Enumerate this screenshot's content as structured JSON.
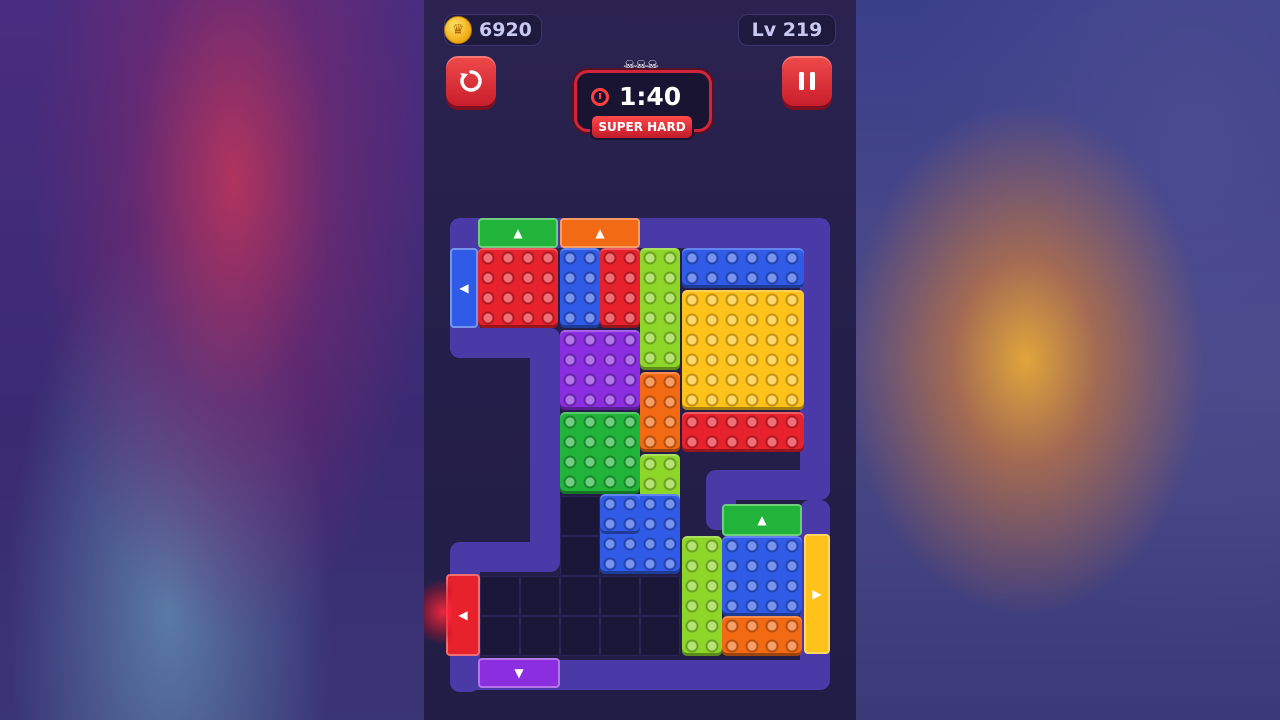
{
  "hud": {
    "coins": "6920",
    "level": "Lv 219",
    "timer": "1:40",
    "difficulty": "SUPER HARD"
  },
  "icons": {
    "coin": "crown-coin-icon",
    "restart": "restart-icon",
    "pause": "pause-icon",
    "timer": "stopwatch-icon",
    "skulls": "skull-icons"
  },
  "colors": {
    "red": "#e8222c",
    "blue": "#2f5be6",
    "green": "#22b43a",
    "lime": "#8ed62a",
    "purple": "#8a2ee0",
    "orange": "#f26a14",
    "yellow": "#ffc21a"
  },
  "board": {
    "blocks": [
      {
        "name": "red-block-2x2",
        "color": "red"
      },
      {
        "name": "blue-block-1x2",
        "color": "blue"
      },
      {
        "name": "red-block-1x2",
        "color": "red"
      },
      {
        "name": "lime-block-1x3",
        "color": "lime"
      },
      {
        "name": "blue-block-3x1",
        "color": "blue"
      },
      {
        "name": "yellow-block-3x3",
        "color": "yellow"
      },
      {
        "name": "purple-block-2x2",
        "color": "purple"
      },
      {
        "name": "orange-block-1x2",
        "color": "orange"
      },
      {
        "name": "red-block-3x1",
        "color": "red"
      },
      {
        "name": "green-block-2x2",
        "color": "green"
      },
      {
        "name": "lime-block-1x2",
        "color": "lime"
      },
      {
        "name": "blue-l-block",
        "color": "blue"
      },
      {
        "name": "lime-block-1x3-bottom",
        "color": "lime"
      },
      {
        "name": "blue-block-2x2-bottom",
        "color": "blue"
      },
      {
        "name": "orange-block-2x1",
        "color": "orange"
      }
    ],
    "gates": [
      {
        "name": "green-exit-gate-top",
        "color": "green",
        "direction": "up"
      },
      {
        "name": "orange-exit-gate-top",
        "color": "orange",
        "direction": "up"
      },
      {
        "name": "blue-exit-gate-left",
        "color": "blue",
        "direction": "left"
      },
      {
        "name": "green-exit-gate-right-top",
        "color": "green",
        "direction": "up"
      },
      {
        "name": "yellow-exit-gate-right",
        "color": "yellow",
        "direction": "right"
      },
      {
        "name": "red-exit-gate-left",
        "color": "red",
        "direction": "left"
      },
      {
        "name": "purple-exit-gate-bottom",
        "color": "purple",
        "direction": "down"
      }
    ]
  }
}
